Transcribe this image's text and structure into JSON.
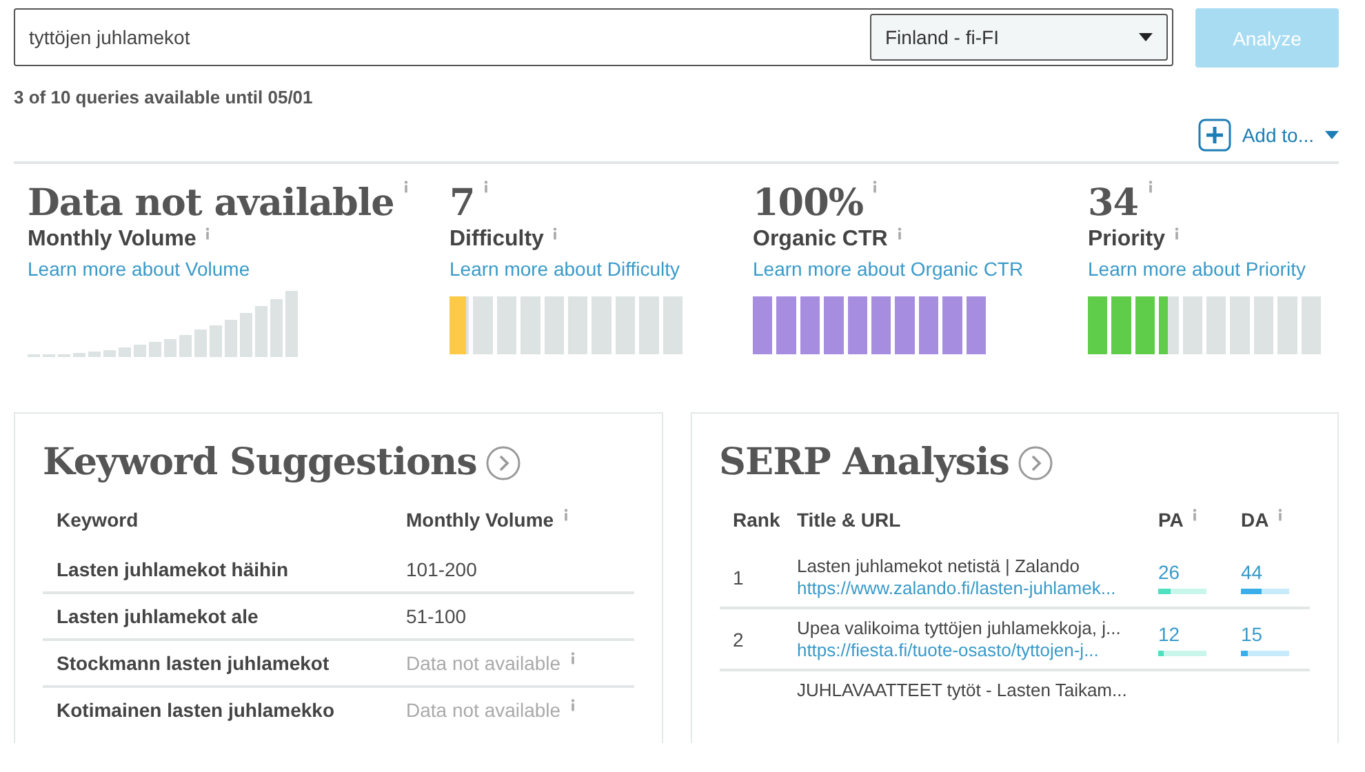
{
  "search": {
    "value": "tyttöjen juhlamekot",
    "locale": "Finland - fi-FI",
    "button": "Analyze",
    "button_disabled": true
  },
  "quota": "3 of 10 queries available until 05/01",
  "add_to": "Add to...",
  "metrics": [
    {
      "kind": "volume",
      "value": "Data not available",
      "label": "Monthly Volume",
      "link": "Learn more about Volume"
    },
    {
      "kind": "meter",
      "value": "7",
      "label": "Difficulty",
      "link": "Learn more about Difficulty",
      "level": 0.07,
      "color": "#fcca46"
    },
    {
      "kind": "meter",
      "value": "100%",
      "label": "Organic CTR",
      "link": "Learn more about Organic CTR",
      "level": 1.0,
      "color": "#a68de0"
    },
    {
      "kind": "meter",
      "value": "34",
      "label": "Priority",
      "link": "Learn more about Priority",
      "level": 0.34,
      "color": "#5fcd4a"
    }
  ],
  "keyword_suggestions": {
    "title": "Keyword Suggestions",
    "columns": [
      "Keyword",
      "Monthly Volume"
    ],
    "rows": [
      {
        "keyword": "Lasten juhlamekot häihin",
        "volume": "101-200",
        "available": true
      },
      {
        "keyword": "Lasten juhlamekot ale",
        "volume": "51-100",
        "available": true
      },
      {
        "keyword": "Stockmann lasten juhlamekot",
        "volume": "Data not available",
        "available": false
      },
      {
        "keyword": "Kotimainen lasten juhlamekko",
        "volume": "Data not available",
        "available": false
      }
    ]
  },
  "serp_analysis": {
    "title": "SERP Analysis",
    "columns": [
      "Rank",
      "Title & URL",
      "PA",
      "DA"
    ],
    "rows": [
      {
        "rank": "1",
        "title": "Lasten juhlamekot netistä | Zalando",
        "url": "https://www.zalando.fi/lasten-juhlamek...",
        "pa": {
          "value": "26",
          "level": 0.26
        },
        "da": {
          "value": "44",
          "level": 0.44
        }
      },
      {
        "rank": "2",
        "title": "Upea valikoima tyttöjen juhlamekkoja, j...",
        "url": "https://fiesta.fi/tuote-osasto/tyttojen-j...",
        "pa": {
          "value": "12",
          "level": 0.12
        },
        "da": {
          "value": "15",
          "level": 0.15
        }
      },
      {
        "title": "JUHLAVAATTEET tytöt - Lasten Taikam..."
      }
    ]
  }
}
